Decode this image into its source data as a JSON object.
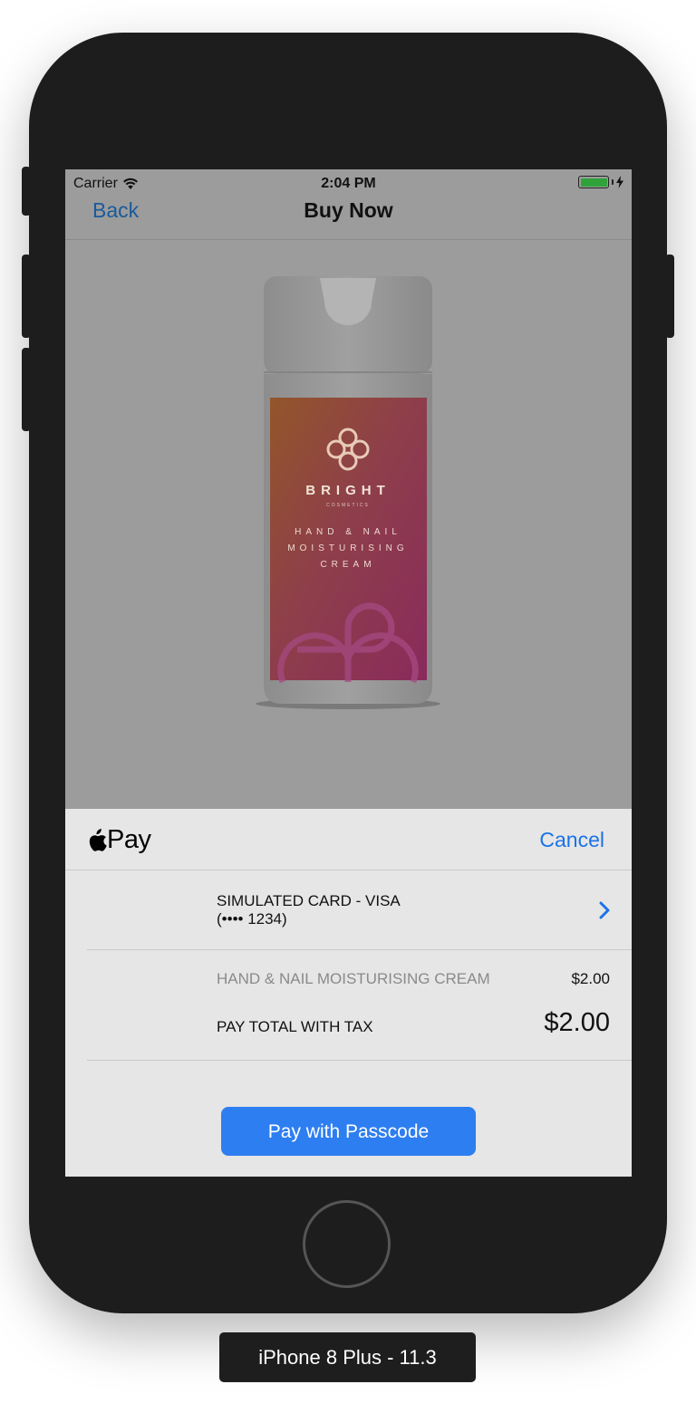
{
  "status_bar": {
    "carrier": "Carrier",
    "time": "2:04 PM",
    "battery_color": "#2fa33a",
    "wifi_icon": "wifi-icon",
    "charging_icon": "bolt-icon"
  },
  "nav": {
    "back_label": "Back",
    "title": "Buy Now",
    "link_color": "#1a5a9c"
  },
  "product": {
    "brand": "BRIGHT",
    "brand_sub": "COSMETICS",
    "line1": "HAND & NAIL",
    "line2": "MOISTURISING",
    "line3": "CREAM"
  },
  "apple_pay": {
    "logo_text": "Pay",
    "logo_icon": "apple-icon",
    "cancel_label": "Cancel",
    "card_line1": "SIMULATED CARD - VISA",
    "card_line2": "(•••• 1234)",
    "item_label": "HAND & NAIL MOISTURISING CREAM",
    "item_price": "$2.00",
    "total_label": "PAY TOTAL WITH TAX",
    "total_price": "$2.00",
    "pay_button_label": "Pay with Passcode",
    "accent_color": "#2d7ef1"
  },
  "device": {
    "label": "iPhone 8 Plus - 11.3"
  }
}
